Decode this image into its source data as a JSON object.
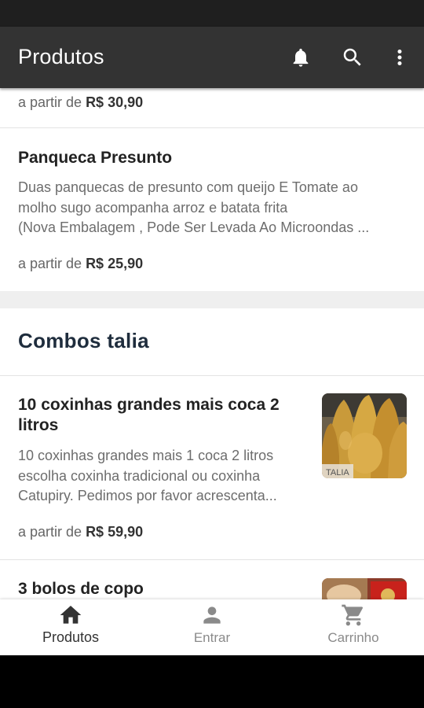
{
  "app_bar": {
    "title": "Produtos"
  },
  "list": {
    "price_prefix": "a partir de",
    "prev_item": {
      "price": "R$ 30,90"
    },
    "items_section1": [
      {
        "name": "Panqueca Presunto",
        "desc_lines": [
          "Duas panquecas de presunto com queijo E Tomate ao",
          "molho sugo acompanha arroz e batata frita",
          "(Nova Embalagem , Pode Ser Levada Ao Microondas ..."
        ],
        "price": "R$ 25,90"
      }
    ],
    "section2": {
      "title": "Combos talia",
      "items": [
        {
          "name_lines": [
            "10 coxinhas grandes  mais coca 2",
            "litros"
          ],
          "desc_lines": [
            "10 coxinhas grandes  mais 1 coca 2 litros",
            "escolha coxinha tradicional ou coxinha",
            "Catupiry. Pedimos por favor acrescenta..."
          ],
          "price": "R$ 59,90",
          "thumb_caption": "TALIA"
        },
        {
          "name_lines": [
            "3 bolos de copo"
          ]
        }
      ]
    }
  },
  "bottom_nav": [
    {
      "label": "Produtos",
      "icon": "home-icon",
      "active": true
    },
    {
      "label": "Entrar",
      "icon": "person-icon",
      "active": false
    },
    {
      "label": "Carrinho",
      "icon": "cart-icon",
      "active": false
    }
  ],
  "colors": {
    "app_bar": "#333333",
    "status_bar": "#1f1f1f",
    "section_title": "#1f2d3d",
    "nav_inactive": "#8a8a8a"
  }
}
